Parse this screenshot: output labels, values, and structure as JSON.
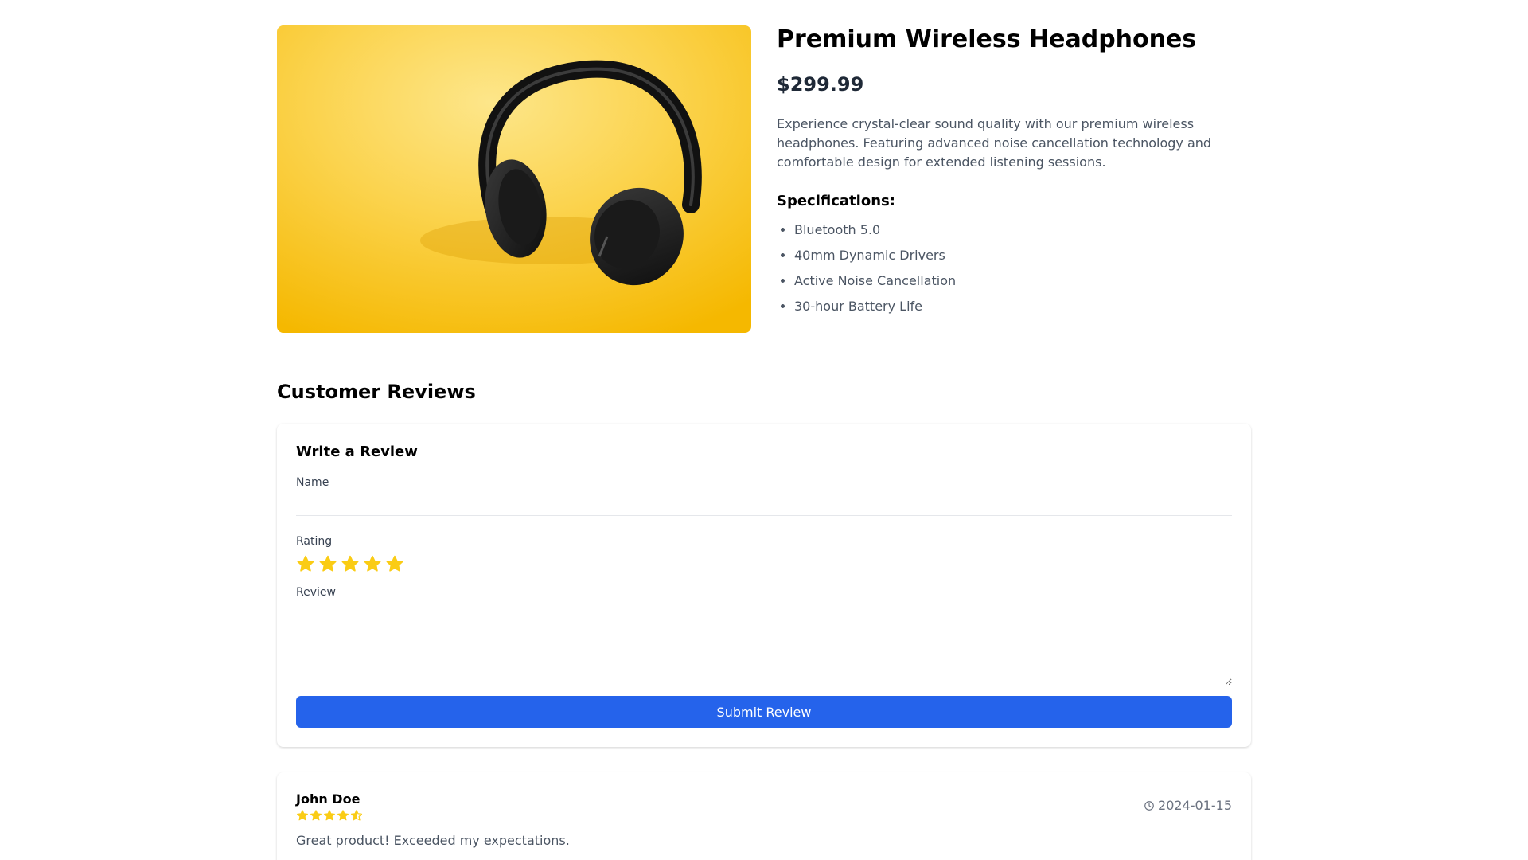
{
  "product": {
    "image_alt": "Black over-ear headphones on yellow background",
    "title": "Premium Wireless Headphones",
    "price": "$299.99",
    "description": "Experience crystal-clear sound quality with our premium wireless headphones. Featuring advanced noise cancellation technology and comfortable design for extended listening sessions.",
    "specs_title": "Specifications:",
    "specs": [
      "Bluetooth 5.0",
      "40mm Dynamic Drivers",
      "Active Noise Cancellation",
      "30-hour Battery Life"
    ]
  },
  "reviews": {
    "heading": "Customer Reviews",
    "form": {
      "title": "Write a Review",
      "name_label": "Name",
      "name_value": "",
      "rating_label": "Rating",
      "rating_value": 5,
      "rating_max": 5,
      "review_label": "Review",
      "review_value": "",
      "submit_label": "Submit Review"
    },
    "items": [
      {
        "author": "John Doe",
        "rating": 4.5,
        "date": "2024-01-15",
        "text": "Great product! Exceeded my expectations."
      }
    ]
  },
  "colors": {
    "star": "#facc15",
    "primary": "#2563eb",
    "image_bg": "#f9c80e"
  },
  "icons": {
    "star": "star-icon",
    "half_star": "star-half-icon",
    "clock": "clock-icon"
  }
}
